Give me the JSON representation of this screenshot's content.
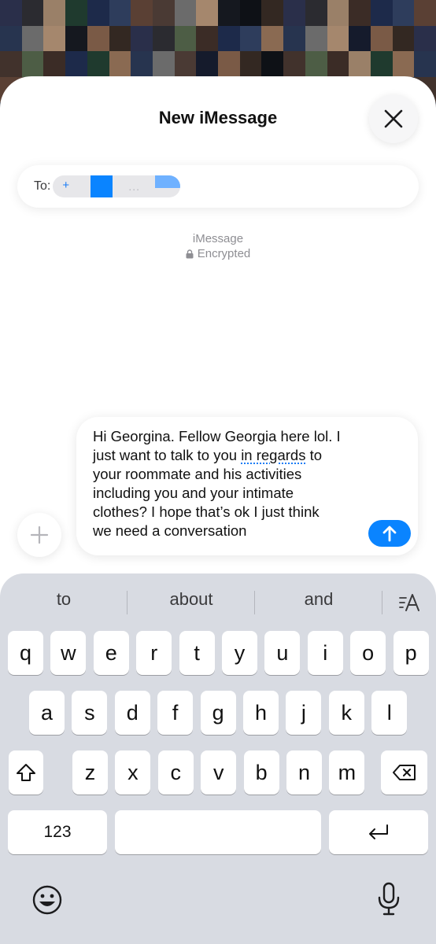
{
  "compose": {
    "title": "New iMessage",
    "to_label": "To:",
    "recipient_visible": "+",
    "recipient_faded": "..."
  },
  "conversation": {
    "service": "iMessage",
    "encryption": "Encrypted"
  },
  "message": {
    "lines": [
      "Hi Georgina. Fellow Georgia here lol. I",
      "just want to talk to you ",
      "in regards",
      " to",
      "your roommate and his activities",
      "including you and your intimate",
      "clothes? I hope that’s ok I just think",
      "we need a conversation"
    ]
  },
  "keyboard": {
    "suggestions": [
      "to",
      "about",
      "and"
    ],
    "row1": [
      "q",
      "w",
      "e",
      "r",
      "t",
      "y",
      "u",
      "i",
      "o",
      "p"
    ],
    "row2": [
      "a",
      "s",
      "d",
      "f",
      "g",
      "h",
      "j",
      "k",
      "l"
    ],
    "row3": [
      "z",
      "x",
      "c",
      "v",
      "b",
      "n",
      "m"
    ],
    "numbers_key": "123",
    "space_key": "",
    "icons": {
      "format": "text-format-icon",
      "shift": "shift-icon",
      "delete": "backspace-icon",
      "return": "return-icon",
      "emoji": "emoji-icon",
      "dictation": "microphone-icon",
      "close": "close-icon",
      "add": "plus-icon",
      "send": "send-arrow-icon",
      "lock": "lock-icon"
    }
  },
  "colors": {
    "accent": "#0a84ff",
    "keyboard_bg": "#d8dbe2",
    "secondary_text": "#8e8e93"
  }
}
